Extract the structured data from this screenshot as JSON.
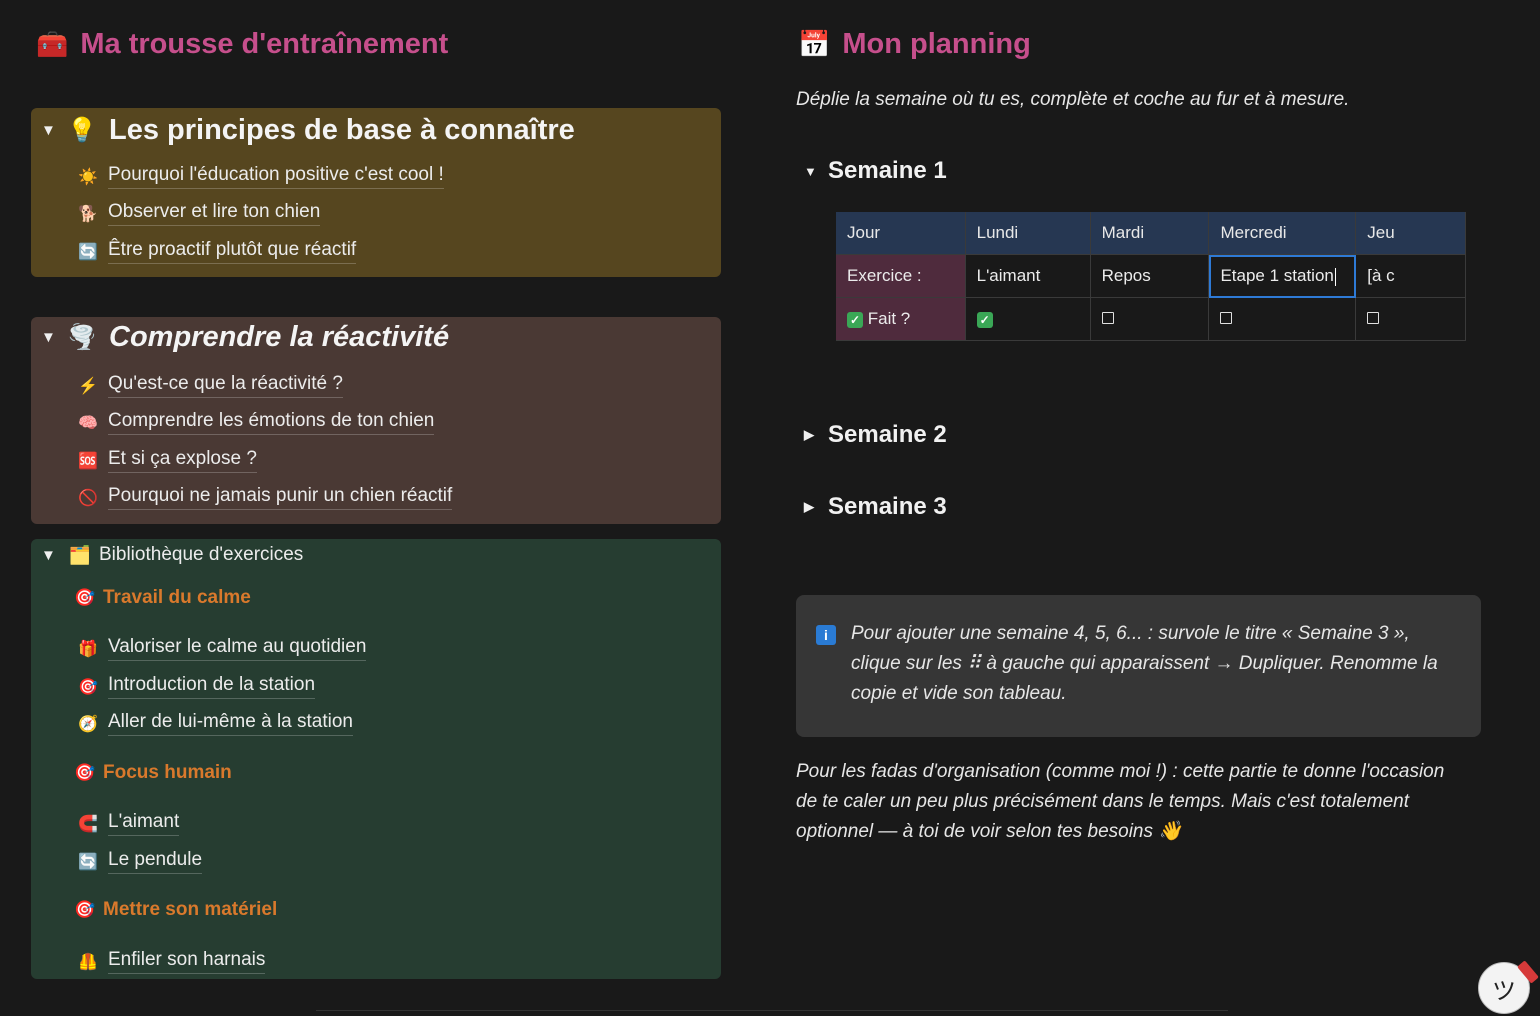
{
  "left": {
    "title": "Ma trousse d'entraînement",
    "title_icon": "toolbox-icon",
    "sections": [
      {
        "heading": "Les principes de base à connaître",
        "icon": "lightbulb-icon",
        "items": [
          {
            "label": "Pourquoi l'éducation positive c'est cool !",
            "icon": "sun-icon"
          },
          {
            "label": "Observer et lire ton chien",
            "icon": "dog-icon"
          },
          {
            "label": "Être proactif plutôt que réactif",
            "icon": "refresh-icon"
          }
        ]
      },
      {
        "heading": "Comprendre la réactivité",
        "icon": "tornado-icon",
        "items": [
          {
            "label": "Qu'est-ce que la réactivité ?",
            "icon": "lightning-icon"
          },
          {
            "label": "Comprendre les émotions de ton chien",
            "icon": "brain-icon"
          },
          {
            "label": "Et si ça explose ?",
            "icon": "sos-icon"
          },
          {
            "label": "Pourquoi ne jamais punir un chien réactif",
            "icon": "prohibited-icon"
          }
        ]
      },
      {
        "heading": "Bibliothèque d'exercices",
        "icon": "folder-icon",
        "groups": [
          {
            "title": "Travail du calme",
            "items": [
              {
                "label": "Valoriser le calme au quotidien",
                "icon": "gift-icon"
              },
              {
                "label": "Introduction de la station",
                "icon": "target-icon"
              },
              {
                "label": "Aller de lui-même à la station",
                "icon": "compass-icon"
              }
            ]
          },
          {
            "title": "Focus humain",
            "items": [
              {
                "label": "L'aimant",
                "icon": "magnet-icon"
              },
              {
                "label": "Le pendule",
                "icon": "refresh-icon"
              }
            ]
          },
          {
            "title": "Mettre son matériel",
            "items": [
              {
                "label": "Enfiler son harnais",
                "icon": "safety-vest-icon"
              }
            ]
          }
        ]
      }
    ]
  },
  "right": {
    "title": "Mon planning",
    "title_icon": "calendar-icon",
    "intro": "Déplie la semaine où tu es, complète et coche au fur et à mesure.",
    "weeks": [
      "Semaine 1",
      "Semaine 2",
      "Semaine 3"
    ],
    "table": {
      "headers": [
        "Jour",
        "Lundi",
        "Mardi",
        "Mercredi",
        "Jeu"
      ],
      "row_exercise": {
        "label": "Exercice :",
        "cells": [
          "L'aimant",
          "Repos",
          "Etape 1 station",
          "[à c"
        ]
      },
      "row_done": {
        "label": "Fait ?",
        "checked": [
          true,
          false,
          false,
          false
        ]
      }
    },
    "callout": "Pour ajouter une semaine 4, 5, 6... : survole le titre « Semaine 3 », clique sur les ⠿ à gauche qui apparaissent → Dupliquer. Renomme la copie et vide son tableau.",
    "note": "Pour les fadas d'organisation (comme moi !) : cette partie te donne l'occasion de te caler un peu plus précisément dans le temps. Mais c'est totalement optionnel — à toi de voir selon tes besoins 👋"
  }
}
